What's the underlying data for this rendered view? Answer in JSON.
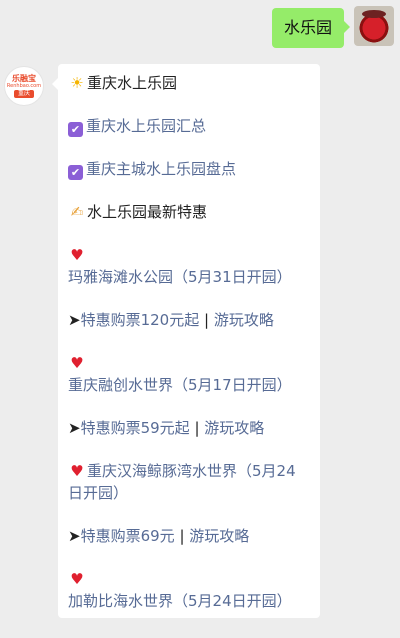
{
  "outgoing": {
    "text": "水乐园"
  },
  "brand_avatar": {
    "line1": "乐融宝",
    "line2": "Renhbao.com",
    "line3": "重庆"
  },
  "message": {
    "title": "重庆水上乐园",
    "link1": "重庆水上乐园汇总",
    "link2": "重庆主城水上乐园盘点",
    "section": "水上乐园最新特惠",
    "park1": "玛雅海滩水公园（5月31日开园）",
    "park1_buy": "特惠购票120元起 ",
    "park1_sep": "|",
    "park1_guide": "  游玩攻略",
    "park2": "重庆融创水世界（5月17日开园）",
    "park2_buy": "特惠购票59元起 ",
    "park2_sep": "|",
    "park2_guide": " 游玩攻略",
    "park3": "重庆汉海鲸豚湾水世界（5月24日开园）",
    "park3_buy": "特惠购票69元 ",
    "park3_sep": "|",
    "park3_guide": " 游玩攻略",
    "park4": "加勒比海水世界（5月24日开园）",
    "arrow": "➤",
    "icons": {
      "sun": "sun-emoji",
      "check": "check-box-emoji",
      "hand": "writing-hand-emoji",
      "heart": "red-heart-emoji"
    }
  },
  "colors": {
    "outgoing_bubble": "#95ec69",
    "link": "#576b95",
    "background": "#ededed"
  }
}
